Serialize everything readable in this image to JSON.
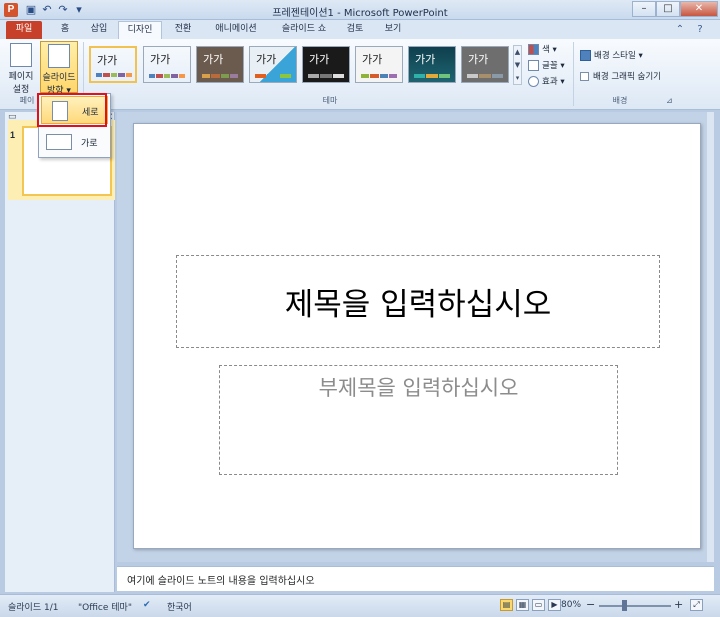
{
  "window": {
    "title": "프레젠테이션1 - Microsoft PowerPoint",
    "app_icon": "P",
    "minimize": "–",
    "maximize": "□",
    "close": "✕"
  },
  "qat": [
    "save-icon",
    "undo-icon",
    "redo-icon",
    "customize-icon"
  ],
  "tabs": {
    "file": "파일",
    "home": "홈",
    "insert": "삽입",
    "design": "디자인",
    "transitions": "전환",
    "animations": "애니메이션",
    "slideshow": "슬라이드 쇼",
    "review": "검토",
    "view": "보기"
  },
  "ribbon": {
    "page_setup": "페이지\n설정",
    "page_setup_l1": "페이지",
    "page_setup_l2": "설정",
    "orientation_l1": "슬라이드",
    "orientation_l2": "방향 ▾",
    "group_page": "페이",
    "group_theme": "테마",
    "themes": [
      {
        "label": "가가",
        "bg": "#ffffff",
        "fg": "#000000"
      },
      {
        "label": "가가",
        "bg": "#ffffff",
        "fg": "#000000"
      },
      {
        "label": "가가",
        "bg": "#6b5a4e",
        "fg": "#ffffff"
      },
      {
        "label": "가가",
        "bg": "#e8f0f6",
        "fg": "#000000"
      },
      {
        "label": "가가",
        "bg": "#1a1a1a",
        "fg": "#ffffff"
      },
      {
        "label": "가가",
        "bg": "#f4f4f4",
        "fg": "#000000"
      },
      {
        "label": "가가",
        "bg": "#0f3f4e",
        "fg": "#ffffff"
      },
      {
        "label": "가가",
        "bg": "#6e6e6e",
        "fg": "#ffffff"
      }
    ],
    "colors": "색 ▾",
    "fonts": "글꼴 ▾",
    "effects": "효과 ▾",
    "bg_styles": "배경 스타일 ▾",
    "hide_bg_graphics": "배경 그래픽 숨기기",
    "group_background": "배경"
  },
  "menu": {
    "portrait": "세로",
    "landscape": "가로"
  },
  "thumbnail": {
    "number": "1"
  },
  "slide": {
    "title_placeholder": "제목을 입력하십시오",
    "subtitle_placeholder": "부제목을 입력하십시오"
  },
  "notes": {
    "placeholder": "여기에 슬라이드 노트의 내용을 입력하십시오"
  },
  "status": {
    "slide_counter": "슬라이드 1/1",
    "theme_name": "\"Office 테마\"",
    "language": "한국어",
    "zoom": "80%",
    "zoom_out": "−",
    "zoom_in": "+"
  },
  "colors": {
    "file_tab": "#c7412a",
    "highlight_box": "#e3101c",
    "selected": "#fcd86b"
  }
}
